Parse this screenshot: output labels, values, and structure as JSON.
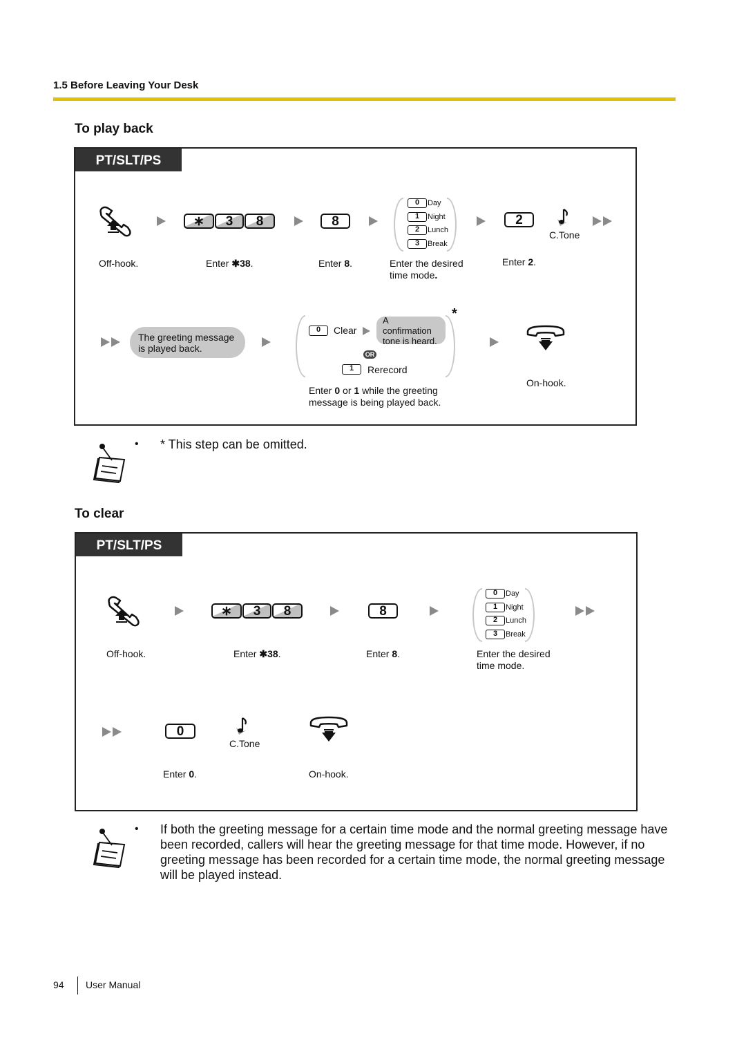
{
  "header": {
    "section": "1.5 Before Leaving Your Desk",
    "rule_color": "#dcc300"
  },
  "playback": {
    "title": "To play back",
    "tag": "PT/SLT/PS",
    "steps": {
      "offhook_label": "Off-hook.",
      "enter_code_prefix": "Enter ",
      "enter_code_value": "✱38",
      "enter_code_suffix": ".",
      "code_keys": [
        "∗",
        "3",
        "8"
      ],
      "key8": "8",
      "enter8_prefix": "Enter ",
      "enter8_value": "8",
      "enter8_suffix": ".",
      "time_modes": [
        {
          "key": "0",
          "label": "Day"
        },
        {
          "key": "1",
          "label": "Night"
        },
        {
          "key": "2",
          "label": "Lunch"
        },
        {
          "key": "3",
          "label": "Break"
        }
      ],
      "timemode_label_1": "Enter the desired",
      "timemode_label_2": "time mode",
      "timemode_label_dot": ".",
      "key2": "2",
      "enter2_prefix": "Enter ",
      "enter2_value": "2",
      "enter2_suffix": ".",
      "ctone": "C.Tone",
      "played_back_1": "The greeting message",
      "played_back_2": "is played back.",
      "clear_key": "0",
      "clear_label": "Clear",
      "confirm_1": "A confirmation",
      "confirm_2": "tone is heard.",
      "or": "OR",
      "rerecord_key": "1",
      "rerecord_label": "Rerecord",
      "optional_mark": "*",
      "choice_label_1a": "Enter ",
      "choice_label_1b": "0",
      "choice_label_1c": " or ",
      "choice_label_1d": "1",
      "choice_label_1e": " while the greeting",
      "choice_label_2": "message is being played back.",
      "onhook_label": "On-hook."
    },
    "note": "* This step can be omitted."
  },
  "clear": {
    "title": "To clear",
    "tag": "PT/SLT/PS",
    "steps": {
      "offhook_label": "Off-hook.",
      "enter_code_prefix": "Enter ",
      "enter_code_value": "✱38",
      "enter_code_suffix": ".",
      "code_keys": [
        "∗",
        "3",
        "8"
      ],
      "key8": "8",
      "enter8_prefix": "Enter ",
      "enter8_value": "8",
      "enter8_suffix": ".",
      "time_modes": [
        {
          "key": "0",
          "label": "Day"
        },
        {
          "key": "1",
          "label": "Night"
        },
        {
          "key": "2",
          "label": "Lunch"
        },
        {
          "key": "3",
          "label": "Break"
        }
      ],
      "timemode_label_1": "Enter the desired",
      "timemode_label_2": "time mode.",
      "key0": "0",
      "enter0_prefix": "Enter ",
      "enter0_value": "0",
      "enter0_suffix": ".",
      "ctone": "C.Tone",
      "onhook_label": "On-hook."
    },
    "note_lines": [
      "If both the greeting message for a certain time mode and the normal greeting message have",
      "been recorded, callers will hear the greeting message for that time mode. However, if no",
      "greeting message has been recorded for a certain time mode, the normal greeting message",
      "will be played instead."
    ]
  },
  "footer": {
    "page_number": "94",
    "doc_title": "User Manual"
  }
}
